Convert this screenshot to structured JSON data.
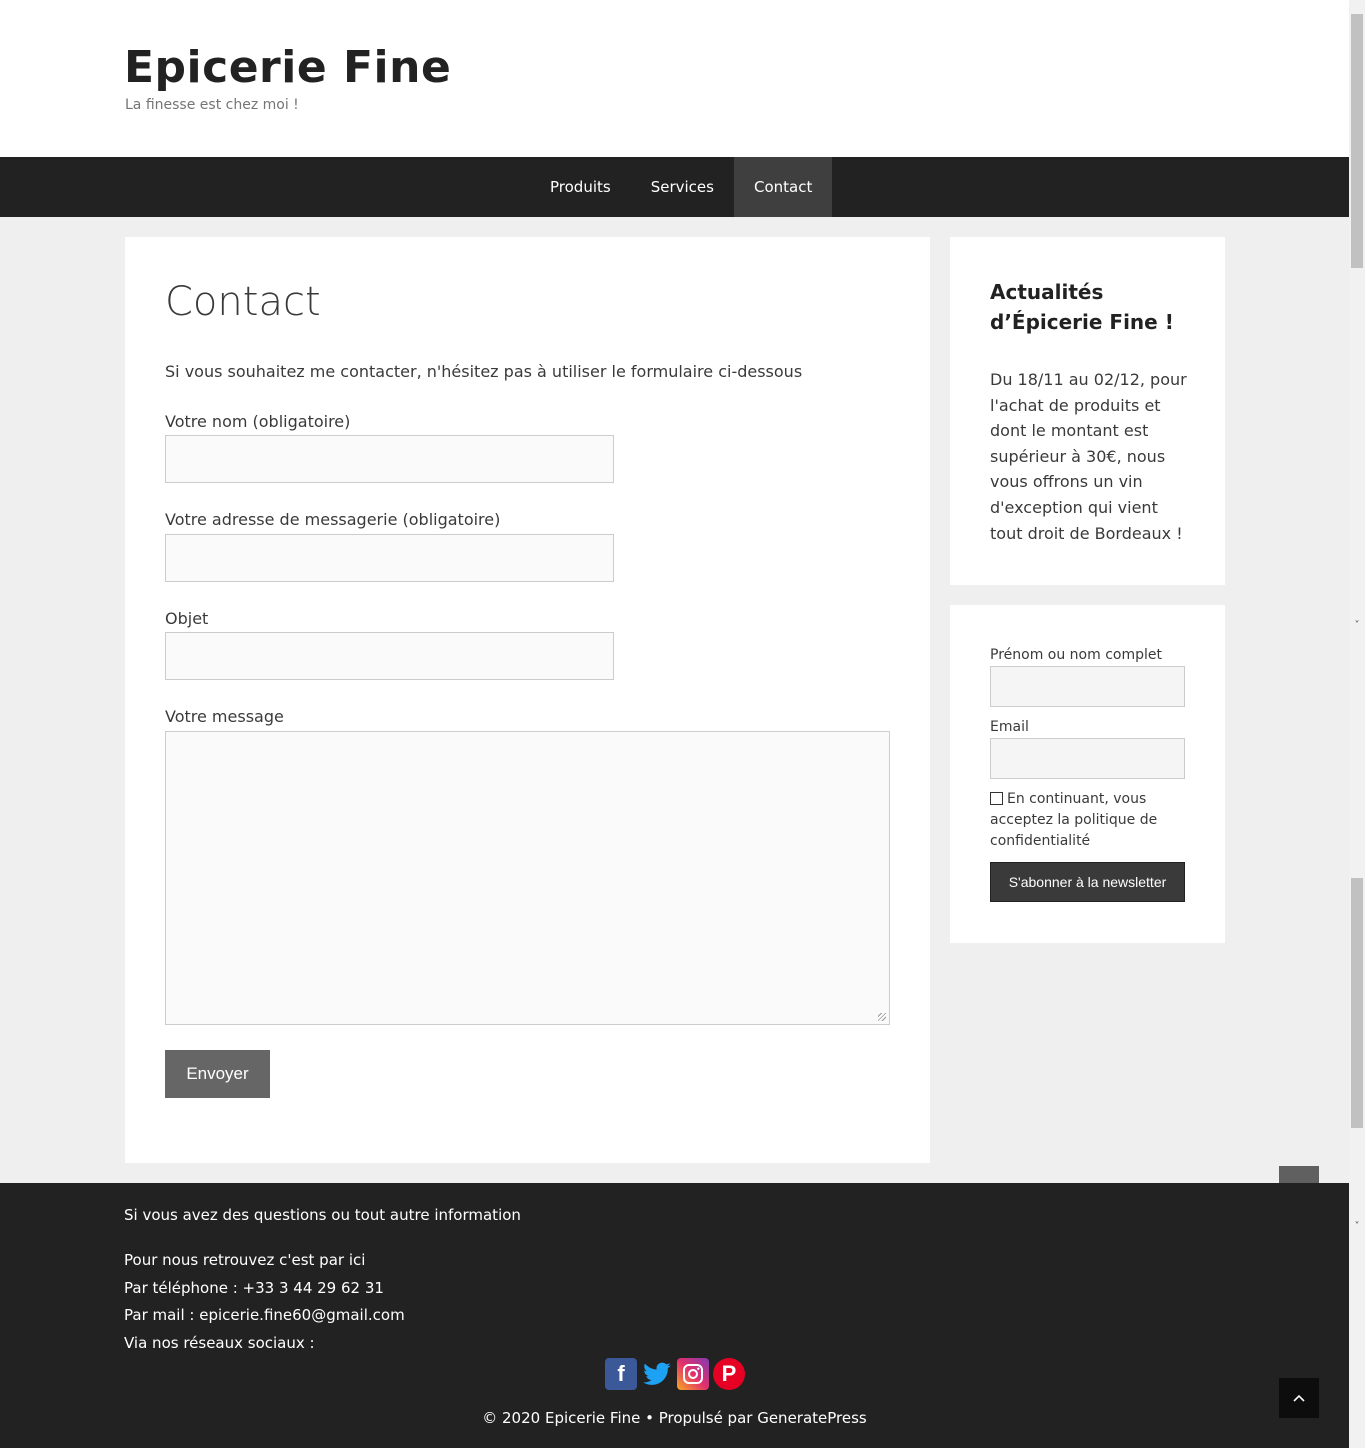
{
  "header": {
    "site_title": "Epicerie Fine",
    "tagline": "La finesse est chez moi !"
  },
  "nav": {
    "items": [
      {
        "label": "Produits"
      },
      {
        "label": "Services"
      },
      {
        "label": "Contact",
        "active": true
      }
    ]
  },
  "main": {
    "title": "Contact",
    "intro": "Si vous souhaitez me contacter, n'hésitez pas à utiliser le formulaire ci-dessous",
    "fields": {
      "name_label": "Votre nom (obligatoire)",
      "name_value": "",
      "email_label": "Votre adresse de messagerie (obligatoire)",
      "email_value": "",
      "subject_label": "Objet",
      "subject_value": "",
      "message_label": "Votre message",
      "message_value": ""
    },
    "submit_label": "Envoyer"
  },
  "sidebar": {
    "news": {
      "title": "Actualités d’Épicerie Fine !",
      "text": "Du 18/11 au 02/12, pour l'achat de produits et dont le montant est supérieur à 30€, nous vous offrons un vin d'exception qui vient tout droit de Bordeaux !"
    },
    "newsletter": {
      "name_label": "Prénom ou nom complet",
      "email_label": "Email",
      "consent_text": "En continuant, vous acceptez la politique de confidentialité",
      "consent_checked": false,
      "button_label": "S'abonner à la newsletter"
    }
  },
  "footer": {
    "question_line": "Si vous avez des questions ou tout autre information",
    "find_us": "Pour nous retrouvez c'est par ici",
    "phone": "Par téléphone : +33 3 44 29 62 31",
    "mail": "Par mail : epicerie.fine60@gmail.com",
    "social_label": "Via nos réseaux sociaux :",
    "social": [
      {
        "icon": "facebook-icon",
        "glyph": "f"
      },
      {
        "icon": "twitter-icon",
        "glyph": "🐦"
      },
      {
        "icon": "instagram-icon",
        "glyph": "◎"
      },
      {
        "icon": "pinterest-icon",
        "glyph": "P"
      }
    ],
    "copyright": "© 2020 Epicerie Fine • Propulsé par GeneratePress"
  },
  "colors": {
    "nav_bg": "#222222",
    "nav_active_bg": "#3f3f3f",
    "page_bg": "#efefef",
    "button_bg": "#666666"
  }
}
